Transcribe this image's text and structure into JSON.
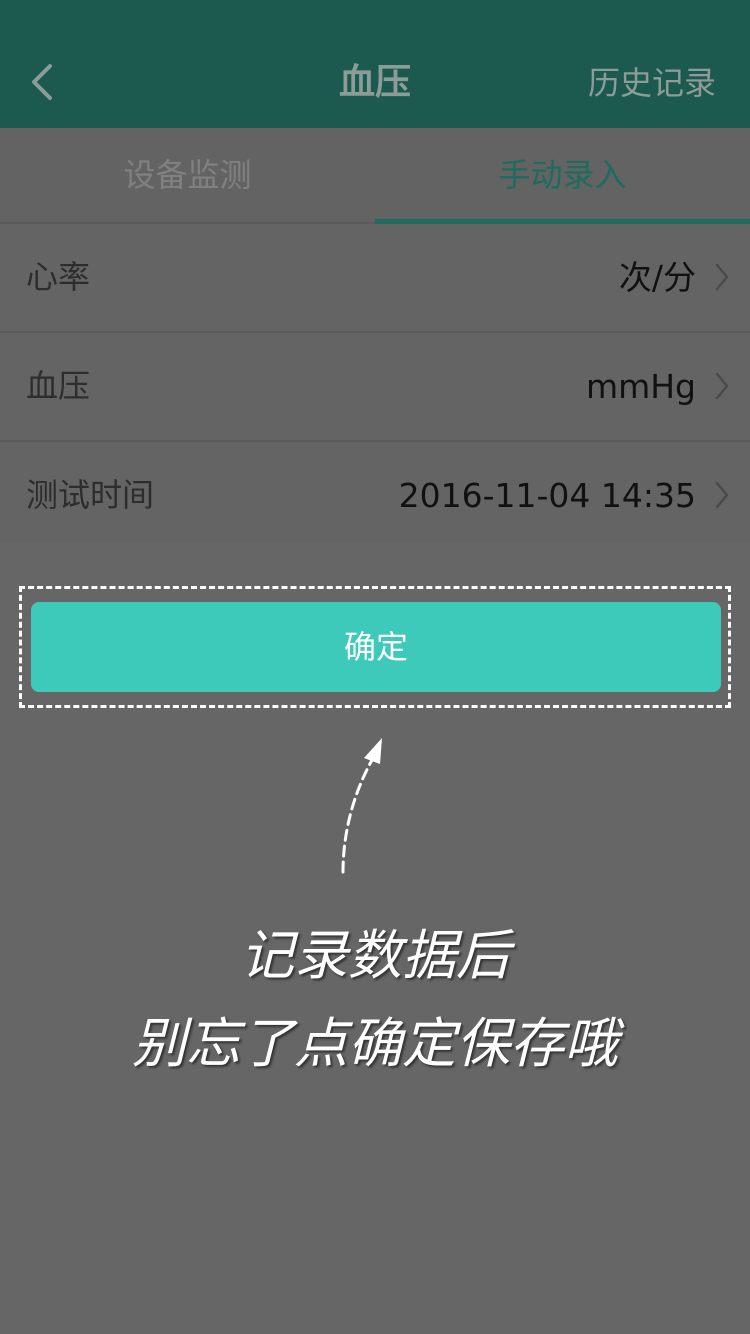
{
  "header": {
    "title": "血压",
    "right_label": "历史记录",
    "back_icon": "chevron-left-icon"
  },
  "tabs": [
    {
      "label": "设备监测",
      "active": false
    },
    {
      "label": "手动录入",
      "active": true
    }
  ],
  "form": {
    "rows": [
      {
        "label": "心率",
        "value": "次/分"
      },
      {
        "label": "血压",
        "value": "mmHg"
      },
      {
        "label": "测试时间",
        "value": "2016-11-04 14:35"
      }
    ]
  },
  "confirm_label": "确定",
  "overlay": {
    "hint_line1": "记录数据后",
    "hint_line2": "别忘了点确定保存哦"
  },
  "colors": {
    "header_bg": "#1c5a4f",
    "accent": "#3ecabb",
    "overlay_bg": "#666666"
  }
}
